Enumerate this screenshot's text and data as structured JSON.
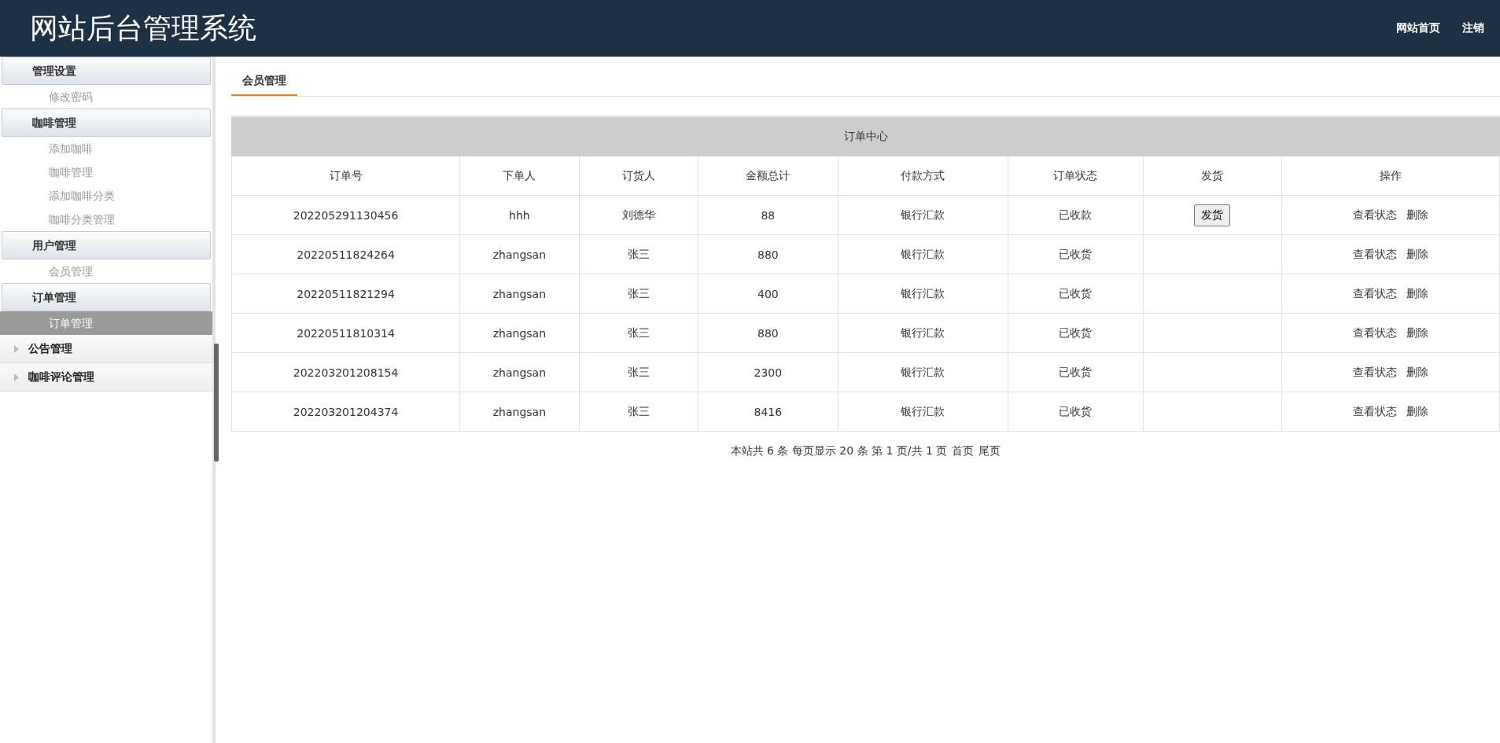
{
  "header": {
    "title": "网站后台管理系统",
    "links": [
      "网站首页",
      "注销"
    ]
  },
  "sidebar": {
    "groups": [
      {
        "label": "管理设置",
        "expanded": true,
        "items": [
          {
            "label": "修改密码",
            "selected": false
          }
        ]
      },
      {
        "label": "咖啡管理",
        "expanded": true,
        "items": [
          {
            "label": "添加咖啡",
            "selected": false
          },
          {
            "label": "咖啡管理",
            "selected": false
          },
          {
            "label": "添加咖啡分类",
            "selected": false
          },
          {
            "label": "咖啡分类管理",
            "selected": false
          }
        ]
      },
      {
        "label": "用户管理",
        "expanded": true,
        "items": [
          {
            "label": "会员管理",
            "selected": false
          }
        ]
      },
      {
        "label": "订单管理",
        "expanded": true,
        "items": [
          {
            "label": "订单管理",
            "selected": true
          }
        ]
      },
      {
        "label": "公告管理",
        "expanded": false
      },
      {
        "label": "咖啡评论管理",
        "expanded": false
      }
    ]
  },
  "tabs": [
    {
      "label": "会员管理",
      "selected": true
    }
  ],
  "table": {
    "caption": "订单中心",
    "columns": [
      "订单号",
      "下单人",
      "订货人",
      "金额总计",
      "付款方式",
      "订单状态",
      "发货",
      "操作"
    ],
    "rows": [
      {
        "cells": [
          "202205291130456",
          "hhh",
          "刘德华",
          "88",
          "银行汇款",
          "已收款"
        ],
        "ship_button": "发货",
        "actions": [
          "查看状态",
          "删除"
        ]
      },
      {
        "cells": [
          "20220511824264",
          "zhangsan",
          "张三",
          "880",
          "银行汇款",
          "已收货"
        ],
        "actions": [
          "查看状态",
          "删除"
        ]
      },
      {
        "cells": [
          "20220511821294",
          "zhangsan",
          "张三",
          "400",
          "银行汇款",
          "已收货"
        ],
        "actions": [
          "查看状态",
          "删除"
        ]
      },
      {
        "cells": [
          "20220511810314",
          "zhangsan",
          "张三",
          "880",
          "银行汇款",
          "已收货"
        ],
        "actions": [
          "查看状态",
          "删除"
        ]
      },
      {
        "cells": [
          "202203201208154",
          "zhangsan",
          "张三",
          "2300",
          "银行汇款",
          "已收货"
        ],
        "actions": [
          "查看状态",
          "删除"
        ]
      },
      {
        "cells": [
          "202203201204374",
          "zhangsan",
          "张三",
          "8416",
          "银行汇款",
          "已收货"
        ],
        "actions": [
          "查看状态",
          "删除"
        ]
      }
    ]
  },
  "pagination": {
    "summary": "本站共  6 条 每页显示 20 条 第 1 页/共 1 页",
    "links": [
      "首页",
      "尾页"
    ]
  }
}
